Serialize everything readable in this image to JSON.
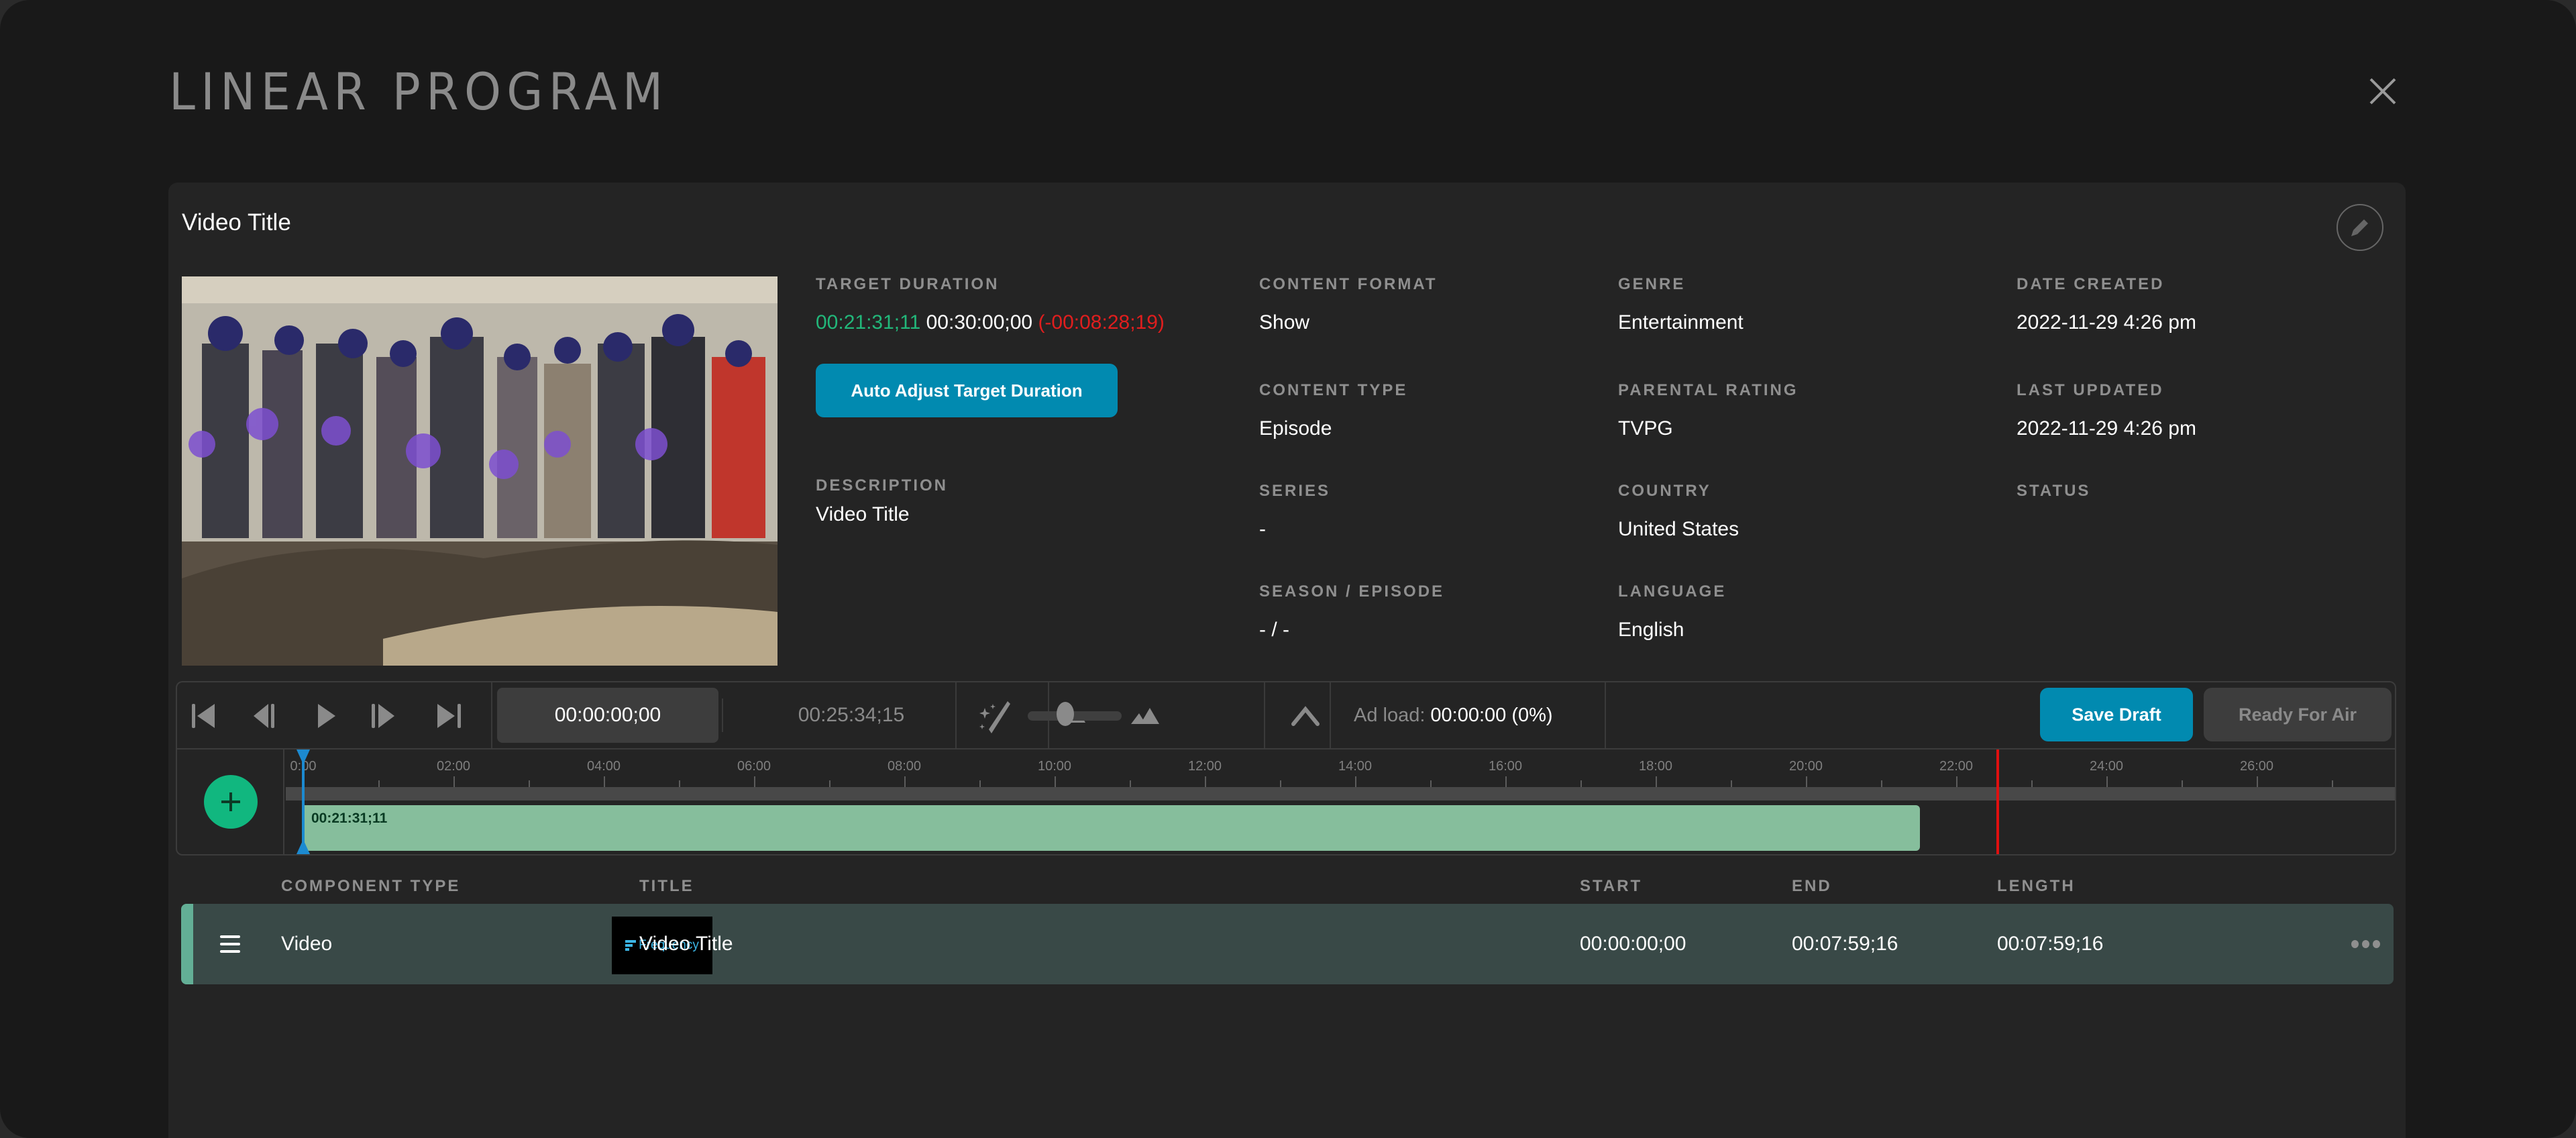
{
  "page": {
    "title": "LINEAR PROGRAM",
    "close_icon": "close-icon"
  },
  "program": {
    "title": "Video Title",
    "edit_icon": "pencil-icon",
    "thumbnail_alt": "Groundbreaking ceremony photo",
    "target_duration": {
      "label": "TARGET DURATION",
      "actual": "00:21:31;11",
      "target": "00:30:00;00",
      "difference": "(-00:08:28;19)",
      "actual_color": "#22b77a",
      "difference_color": "#e01e1e"
    },
    "auto_adjust_label": "Auto Adjust Target Duration",
    "description": {
      "label": "DESCRIPTION",
      "value": "Video Title"
    },
    "fields": {
      "content_format": {
        "label": "CONTENT FORMAT",
        "value": "Show"
      },
      "content_type": {
        "label": "CONTENT TYPE",
        "value": "Episode"
      },
      "series": {
        "label": "SERIES",
        "value": "-"
      },
      "season_episode": {
        "label": "SEASON / EPISODE",
        "value": "- / -"
      },
      "genre": {
        "label": "GENRE",
        "value": "Entertainment"
      },
      "parental_rating": {
        "label": "PARENTAL RATING",
        "value": "TVPG"
      },
      "country": {
        "label": "COUNTRY",
        "value": "United States"
      },
      "language": {
        "label": "LANGUAGE",
        "value": "English"
      },
      "date_created": {
        "label": "DATE CREATED",
        "value": "2022-11-29 4:26 pm"
      },
      "last_updated": {
        "label": "LAST UPDATED",
        "value": "2022-11-29 4:26 pm"
      },
      "status": {
        "label": "STATUS",
        "value": ""
      }
    }
  },
  "toolbar": {
    "icons": [
      "skip-to-start-icon",
      "step-back-icon",
      "play-icon",
      "step-forward-icon",
      "skip-to-end-icon"
    ],
    "current_timecode": "00:00:00;00",
    "total_timecode": "00:25:34;15",
    "magic_icon": "magic-wand-icon",
    "zoom_level": 0.4,
    "collapse_icon": "chevron-up-icon",
    "ad_load_label": "Ad load:",
    "ad_load_value": "00:00:00 (0%)",
    "save_draft_label": "Save Draft",
    "ready_for_air_label": "Ready For Air",
    "accent_color": "#018ab0"
  },
  "timeline": {
    "add_icon": "plus-icon",
    "tick_labels": [
      "0:00",
      "02:00",
      "04:00",
      "06:00",
      "08:00",
      "10:00",
      "12:00",
      "14:00",
      "16:00",
      "18:00",
      "20:00",
      "22:00",
      "24:00",
      "26:00"
    ],
    "visible_minutes": 28.3,
    "playhead_minutes": 0,
    "target_marker_minutes": 22.55,
    "clip": {
      "label": "00:21:31;11",
      "start_minutes": 0,
      "end_minutes": 21.52,
      "color": "#86be9c"
    }
  },
  "components": {
    "headers": {
      "type": "COMPONENT TYPE",
      "title": "TITLE",
      "start": "START",
      "end": "END",
      "length": "LENGTH"
    },
    "rows": [
      {
        "type": "Video",
        "thumbnail_text": "Frequency",
        "title": "Video Title",
        "start": "00:00:00;00",
        "end": "00:07:59;16",
        "length": "00:07:59;16"
      }
    ]
  }
}
